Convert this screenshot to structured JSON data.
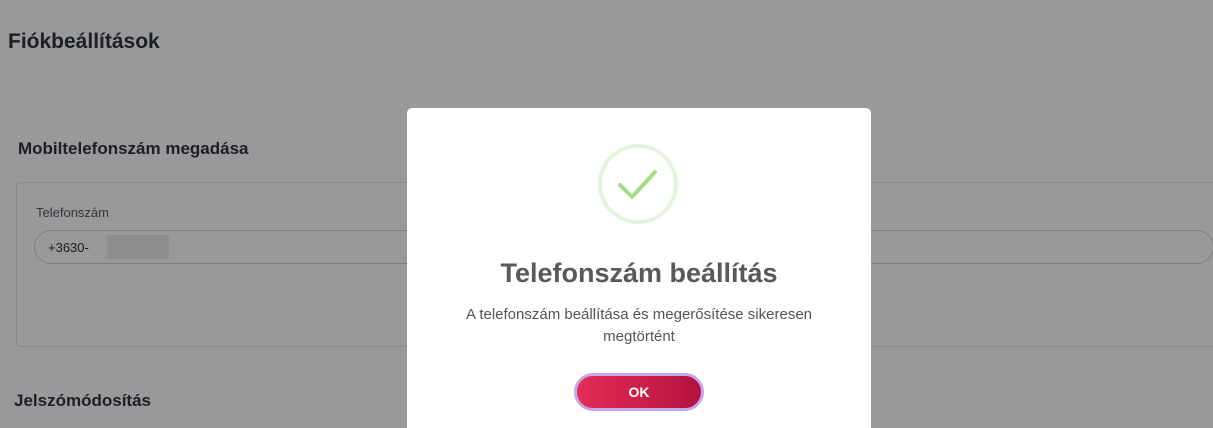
{
  "page": {
    "title": "Fiókbeállítások"
  },
  "phone_section": {
    "title": "Mobiltelefonszám megadása",
    "field_label": "Telefonszám",
    "field_value": "+3630-"
  },
  "password_section": {
    "title": "Jelszómódosítás"
  },
  "modal": {
    "icon": "checkmark-icon",
    "title": "Telefonszám beállítás",
    "message": "A telefonszám beállítása és megerősítése sikeresen megtörtént",
    "ok_label": "OK"
  },
  "colors": {
    "heading": "#2f3542",
    "success_check": "#a5dc86",
    "ok_gradient_start": "#e32d55",
    "ok_gradient_end": "#b5123f",
    "ok_border": "#c4a6f0"
  }
}
